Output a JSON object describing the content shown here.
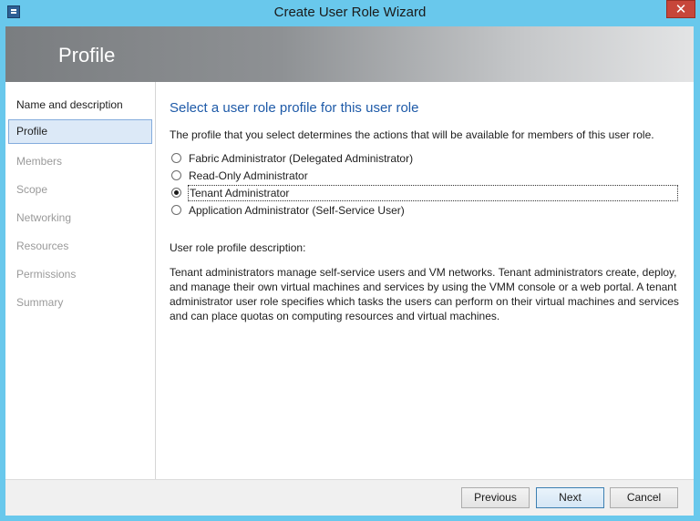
{
  "window": {
    "title": "Create User Role Wizard",
    "close_glyph": "✕"
  },
  "banner": {
    "title": "Profile"
  },
  "sidebar": {
    "items": [
      {
        "label": "Name and description"
      },
      {
        "label": "Profile"
      },
      {
        "label": "Members"
      },
      {
        "label": "Scope"
      },
      {
        "label": "Networking"
      },
      {
        "label": "Resources"
      },
      {
        "label": "Permissions"
      },
      {
        "label": "Summary"
      }
    ]
  },
  "main": {
    "heading": "Select a user role profile for this user role",
    "intro": "The profile that you select determines the actions that will be available for members of this user role.",
    "options": [
      {
        "label": "Fabric Administrator (Delegated Administrator)",
        "selected": false
      },
      {
        "label": "Read-Only Administrator",
        "selected": false
      },
      {
        "label": "Tenant Administrator",
        "selected": true
      },
      {
        "label": "Application Administrator (Self-Service User)",
        "selected": false
      }
    ],
    "description_label": "User role profile description:",
    "description": "Tenant administrators manage self-service users and VM networks. Tenant administrators create, deploy, and manage their own virtual machines and services by using the VMM console or a web portal. A tenant administrator user role specifies which tasks the users can perform on their virtual machines and services and can place quotas on computing resources and virtual machines."
  },
  "footer": {
    "previous_label": "Previous",
    "next_label": "Next",
    "cancel_label": "Cancel"
  },
  "colors": {
    "frame": "#69c8ec",
    "heading": "#1e5aa8",
    "selected_nav": "#dce9f7",
    "close": "#c7463a"
  }
}
